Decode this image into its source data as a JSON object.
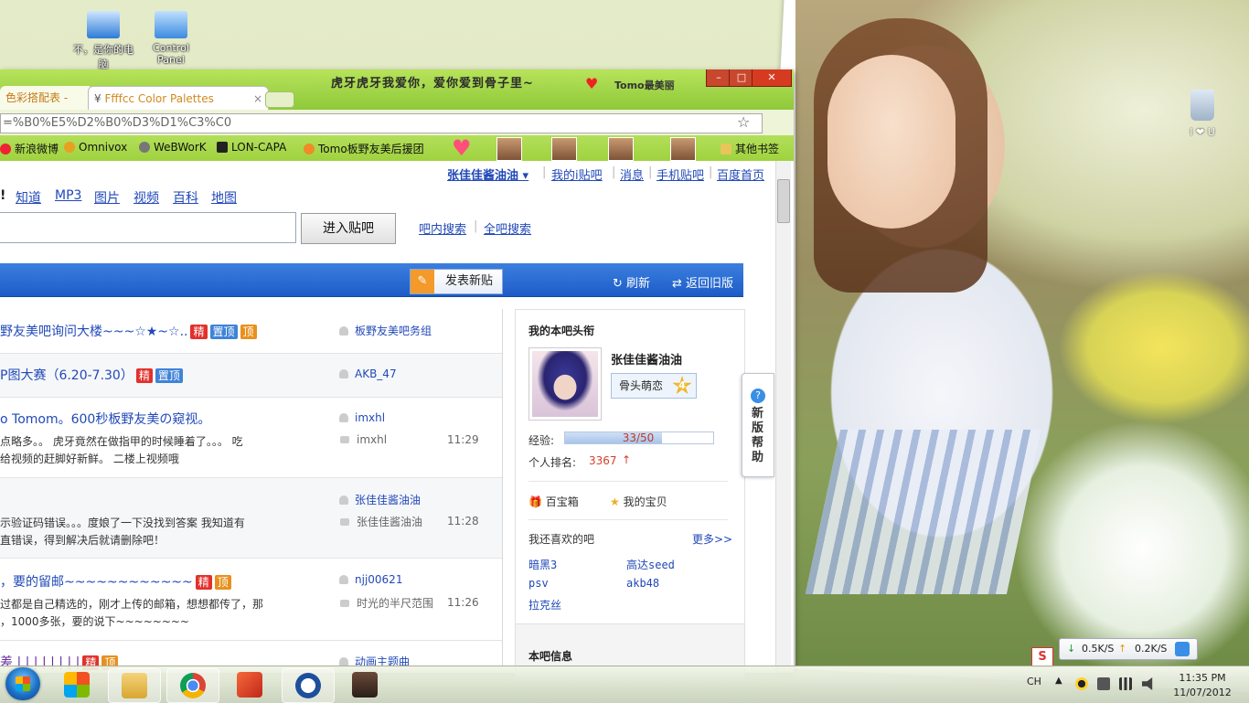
{
  "desktop": {
    "icons": [
      {
        "label": "不，是你的电脑"
      },
      {
        "label": "Control Panel"
      }
    ],
    "recycle_label": "I ❤ U"
  },
  "browser": {
    "theme_text": "虎牙虎牙我爱你，爱你爱到骨子里~",
    "theme_text2": "Tomo最美丽",
    "tabs": [
      {
        "label": "色彩搭配表 -",
        "close": "×"
      },
      {
        "label": "Ffffcc Color Palettes",
        "close": "×"
      }
    ],
    "window_buttons": {
      "minimize": "–",
      "maximize": "□",
      "close": "✕"
    },
    "address": "=%B0%E5%D2%B0%D3%D1%C3%C0",
    "bookmarks": [
      {
        "label": "新浪微博"
      },
      {
        "label": "Omnivox"
      },
      {
        "label": "WeBWorK"
      },
      {
        "label": "LON-CAPA"
      },
      {
        "label": "Tomo板野友美后援团"
      },
      {
        "label": "其他书签"
      }
    ]
  },
  "page": {
    "top_links": {
      "user": "张佳佳酱油油",
      "my_tieba": "我的i贴吧",
      "messages": "消息",
      "mobile": "手机贴吧",
      "baidu_home": "百度首页"
    },
    "nav": [
      "知道",
      "MP3",
      "图片",
      "视频",
      "百科",
      "地图"
    ],
    "search": {
      "button": "进入贴吧",
      "in_bar": "吧内搜索",
      "all_bar": "全吧搜索"
    },
    "bluebar": {
      "post": "发表新贴",
      "refresh": "刷新",
      "old": "返回旧版"
    },
    "threads": [
      {
        "title": "野友美吧询问大楼~~~☆★~☆..",
        "badges": [
          "精",
          "置顶",
          "顶"
        ],
        "author": "板野友美吧务组"
      },
      {
        "title": "P图大赛（6.20-7.30）",
        "badges": [
          "精",
          "置顶"
        ],
        "author": "AKB_47"
      },
      {
        "title": "o Tomom。600秒板野友美の窥视。",
        "badges": [],
        "author": "imxhl",
        "abstract": [
          "点略多。。 虎牙竟然在做指甲的时候睡着了。。。 吃",
          "给视频的赶脚好新鲜。 二楼上视频哦"
        ],
        "reply": "imxhl",
        "time": "11:29"
      },
      {
        "title": "",
        "badges": [],
        "author": "张佳佳酱油油",
        "abstract": [
          "示验证码错误。。。度娘了一下没找到答案 我知道有",
          "直错误，得到解决后就请删除吧！"
        ],
        "reply": "张佳佳酱油油",
        "time": "11:28"
      },
      {
        "title": "，要的留邮~~~~~~~~~~~~",
        "badges": [
          "精",
          "顶"
        ],
        "author": "njj00621",
        "abstract": [
          "过都是自己精选的，刚才上传的邮箱，想想都传了，那",
          "，1000多张，要的说下~~~~~~~~"
        ],
        "reply": "时光的半尺范围",
        "time": "11:26"
      },
      {
        "title": "差 | | | | | | | |",
        "badges": [
          "精",
          "顶"
        ],
        "author": "动画主题曲"
      }
    ],
    "sidebar": {
      "title": "我的本吧头衔",
      "username": "张佳佳酱油油",
      "level_title": "骨头萌恋",
      "level": "4",
      "exp_label": "经验:",
      "exp_text": "33/50",
      "exp_fraction": 0.66,
      "rank_label": "个人排名:",
      "rank_value": "3367",
      "treasure": "百宝箱",
      "my_items": "我的宝贝",
      "liked_title": "我还喜欢的吧",
      "more": "更多>>",
      "liked": [
        "暗黑3",
        "高达seed",
        "psv",
        "akb48",
        "拉克丝"
      ],
      "info_title": "本吧信息"
    },
    "help_tab": "新版帮助"
  },
  "taskbar": {
    "lang": "CH",
    "time": "11:35 PM",
    "date": "11/07/2012",
    "net_down": "0.5K/S",
    "net_up": "0.2K/S"
  },
  "colors": {
    "accent_blue": "#1d5cc6",
    "link": "#2149b8",
    "theme_green": "#9fd23f"
  }
}
